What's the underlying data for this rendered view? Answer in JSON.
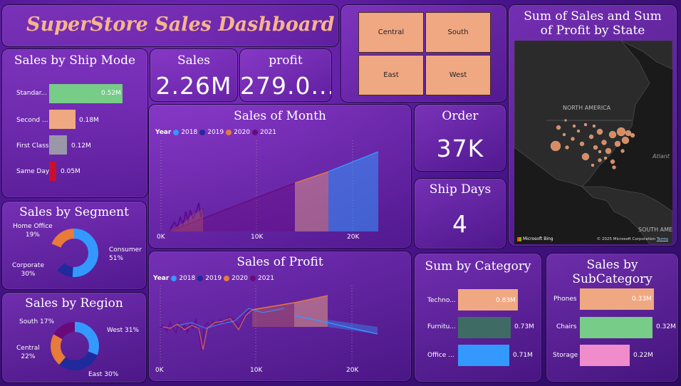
{
  "dashboard_title": "SuperStore Sales Dashboard",
  "colors": {
    "peach": "#f0a882",
    "green": "#77cc88",
    "gray": "#9a98a8",
    "red": "#c8102e",
    "blue": "#3399ff",
    "navy": "#1f2a9c",
    "orange": "#e87a3a",
    "purple": "#6a0a7a",
    "teal": "#3e6b64",
    "pink": "#f08ccc"
  },
  "region_buttons": [
    "Central",
    "South",
    "East",
    "West"
  ],
  "map": {
    "title": "Sum of Sales and Sum of Profit by State",
    "label_north_america": "NORTH AMERICA",
    "label_atlantic": "Atlant",
    "label_south_america": "SOUTH AMER",
    "bing_label": "Microsoft Bing",
    "copyright": "© 2025 Microsoft Corporation",
    "terms": "Terms"
  },
  "kpis": {
    "sales_label": "Sales",
    "sales_value": "2.26M",
    "profit_label": "profit",
    "profit_value": "279.0...",
    "order_label": "Order",
    "order_value": "37K",
    "shipdays_label": "Ship Days",
    "shipdays_value": "4"
  },
  "ship_mode": {
    "title": "Sales by Ship Mode",
    "items": [
      {
        "label": "Standar...",
        "value": "0.52M",
        "amount": 0.52
      },
      {
        "label": "Second ...",
        "value": "0.18M",
        "amount": 0.18
      },
      {
        "label": "First Class",
        "value": "0.12M",
        "amount": 0.12
      },
      {
        "label": "Same Day",
        "value": "0.05M",
        "amount": 0.05
      }
    ]
  },
  "segment": {
    "title": "Sales by Segment",
    "home_office": "Home Office",
    "home_office_pct": "19%",
    "consumer": "Consumer",
    "consumer_pct": "51%",
    "corporate": "Corporate",
    "corporate_pct": "30%"
  },
  "region_donut": {
    "title": "Sales by Region",
    "south": "South 17%",
    "west": "West 31%",
    "central": "Central",
    "central_pct": "22%",
    "east": "East 30%"
  },
  "legend": {
    "year_label": "Year",
    "years": [
      "2018",
      "2019",
      "2020",
      "2021"
    ]
  },
  "category": {
    "title": "Sum by Category",
    "items": [
      {
        "label": "Techno...",
        "value": "0.83M",
        "amount": 0.83
      },
      {
        "label": "Furnitu...",
        "value": "0.73M",
        "amount": 0.73
      },
      {
        "label": "Office ...",
        "value": "0.71M",
        "amount": 0.71
      }
    ]
  },
  "subcategory": {
    "title": "Sales by SubCategory",
    "items": [
      {
        "label": "Phones",
        "value": "0.33M",
        "amount": 0.33
      },
      {
        "label": "Chairs",
        "value": "0.32M",
        "amount": 0.32
      },
      {
        "label": "Storage",
        "value": "0.22M",
        "amount": 0.22
      }
    ]
  },
  "chart_data": [
    {
      "type": "area",
      "title": "Sales of Month",
      "legend_title": "Year",
      "series": [
        {
          "name": "2018",
          "color": "#3399ff"
        },
        {
          "name": "2019",
          "color": "#1f2a9c"
        },
        {
          "name": "2020",
          "color": "#e87a3a"
        },
        {
          "name": "2021",
          "color": "#6a0a7a"
        }
      ],
      "x_ticks": [
        "0K",
        "10K",
        "20K"
      ],
      "xlim": [
        0,
        23000
      ]
    },
    {
      "type": "area",
      "title": "Sales of Profit",
      "legend_title": "Year",
      "series": [
        {
          "name": "2018",
          "color": "#3399ff"
        },
        {
          "name": "2019",
          "color": "#1f2a9c"
        },
        {
          "name": "2020",
          "color": "#e87a3a"
        },
        {
          "name": "2021",
          "color": "#6a0a7a"
        }
      ],
      "x_ticks": [
        "0K",
        "10K",
        "20K"
      ],
      "xlim": [
        0,
        23000
      ]
    }
  ]
}
